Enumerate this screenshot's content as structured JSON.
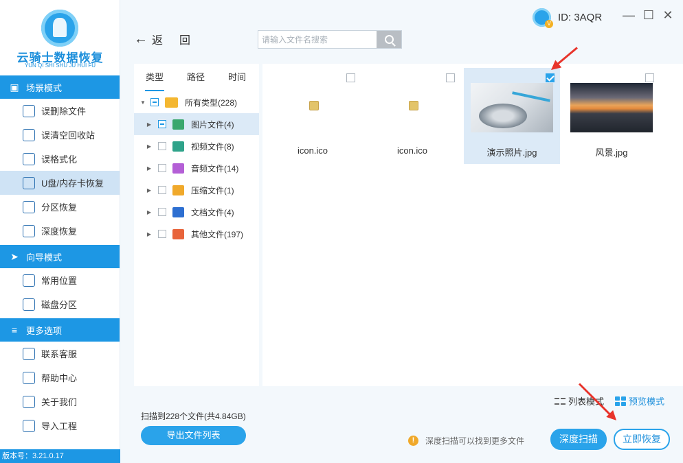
{
  "app": {
    "logo_title": "云骑士数据恢复",
    "logo_subtitle": "YUN QI SHI SHU JU HUI FU",
    "version": "版本号：3.21.0.17",
    "user_id": "ID: 3AQR"
  },
  "window_controls": {
    "minimize": "—",
    "maximize": "☐",
    "close": "✕"
  },
  "sidebar": {
    "sections": [
      {
        "title": "场景模式",
        "icon": "scene-icon",
        "items": [
          {
            "label": "误删除文件",
            "icon": "delete-file-icon",
            "active": false
          },
          {
            "label": "误清空回收站",
            "icon": "recycle-bin-icon",
            "active": false
          },
          {
            "label": "误格式化",
            "icon": "format-icon",
            "active": false
          },
          {
            "label": "U盘/内存卡恢复",
            "icon": "sd-card-icon",
            "active": true
          },
          {
            "label": "分区恢复",
            "icon": "partition-icon",
            "active": false
          },
          {
            "label": "深度恢复",
            "icon": "deep-recover-icon",
            "active": false
          }
        ]
      },
      {
        "title": "向导模式",
        "icon": "signpost-icon",
        "items": [
          {
            "label": "常用位置",
            "icon": "windows-icon",
            "active": false
          },
          {
            "label": "磁盘分区",
            "icon": "disk-icon",
            "active": false
          }
        ]
      },
      {
        "title": "更多选项",
        "icon": "menu-icon",
        "items": [
          {
            "label": "联系客服",
            "icon": "phone-icon",
            "active": false
          },
          {
            "label": "帮助中心",
            "icon": "help-icon",
            "active": false
          },
          {
            "label": "关于我们",
            "icon": "info-icon",
            "active": false
          },
          {
            "label": "导入工程",
            "icon": "import-icon",
            "active": false
          }
        ]
      }
    ]
  },
  "toolbar": {
    "back_char1": "返",
    "back_char2": "回",
    "search_placeholder": "请输入文件名搜索"
  },
  "tree": {
    "tabs": [
      "类型",
      "路径",
      "时间"
    ],
    "active_tab": 0,
    "root_label": "所有类型(228)",
    "items": [
      {
        "label": "图片文件(4)",
        "color": "#3aa76d",
        "selected": true,
        "partial": true
      },
      {
        "label": "视频文件(8)",
        "color": "#2fa38a",
        "selected": false,
        "partial": false
      },
      {
        "label": "音频文件(14)",
        "color": "#b45fd6",
        "selected": false,
        "partial": false
      },
      {
        "label": "压缩文件(1)",
        "color": "#f0a92b",
        "selected": false,
        "partial": false
      },
      {
        "label": "文档文件(4)",
        "color": "#2d6fd1",
        "selected": false,
        "partial": false
      },
      {
        "label": "其他文件(197)",
        "color": "#e8643b",
        "selected": false,
        "partial": false
      }
    ]
  },
  "files": [
    {
      "name": "icon.ico",
      "kind": "ico",
      "checked": false,
      "selected": false
    },
    {
      "name": "icon.ico",
      "kind": "ico",
      "checked": false,
      "selected": false
    },
    {
      "name": "演示照片.jpg",
      "kind": "hdd-photo",
      "checked": true,
      "selected": true
    },
    {
      "name": "风景.jpg",
      "kind": "landscape",
      "checked": false,
      "selected": false
    }
  ],
  "bottom": {
    "scan_info": "扫描到228个文件(共4.84GB)",
    "export_label": "导出文件列表",
    "hint": "深度扫描可以找到更多文件",
    "list_mode": "列表模式",
    "preview_mode": "预览模式",
    "deep_scan_label": "深度扫描",
    "recover_label": "立即恢复"
  },
  "colors": {
    "accent": "#1d97e4",
    "annotation_arrow": "#e8342b"
  }
}
